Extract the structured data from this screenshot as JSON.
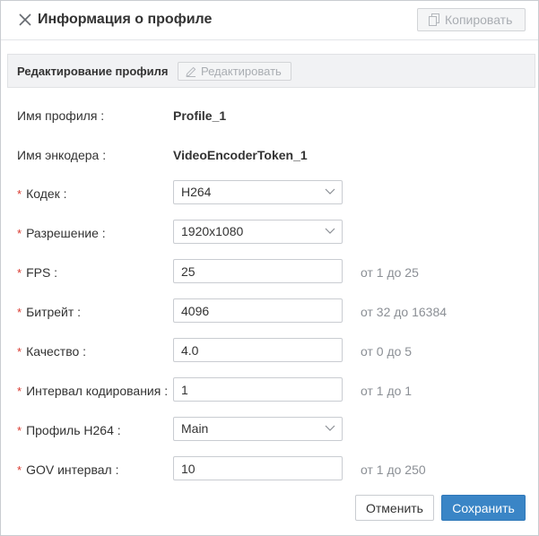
{
  "header": {
    "title": "Информация о профиле",
    "copy_label": "Копировать"
  },
  "section": {
    "title": "Редактирование профиля",
    "edit_label": "Редактировать"
  },
  "info": {
    "profile_name_label": "Имя профиля",
    "profile_name_value": "Profile_1",
    "encoder_name_label": "Имя энкодера",
    "encoder_name_value": "VideoEncoderToken_1"
  },
  "form": {
    "required_mark": "*",
    "codec": {
      "label": "Кодек",
      "value": "H264"
    },
    "resolution": {
      "label": "Разрешение",
      "value": "1920x1080"
    },
    "fps": {
      "label": "FPS",
      "value": "25",
      "hint": "от 1 до 25"
    },
    "bitrate": {
      "label": "Битрейт",
      "value": "4096",
      "hint": "от 32 до 16384"
    },
    "quality": {
      "label": "Качество",
      "value": "4.0",
      "hint": "от 0 до 5"
    },
    "encoding_interval": {
      "label": "Интервал кодирования",
      "value": "1",
      "hint": "от 1 до 1"
    },
    "h264_profile": {
      "label": "Профиль H264",
      "value": "Main"
    },
    "gov_interval": {
      "label": "GOV интервал",
      "value": "10",
      "hint": "от 1 до 250"
    }
  },
  "footer": {
    "cancel_label": "Отменить",
    "save_label": "Сохранить"
  },
  "colors": {
    "primary": "#3a85c6",
    "required": "#d9392f",
    "hint": "#8b8f95",
    "section_bg": "#f1f2f4"
  }
}
